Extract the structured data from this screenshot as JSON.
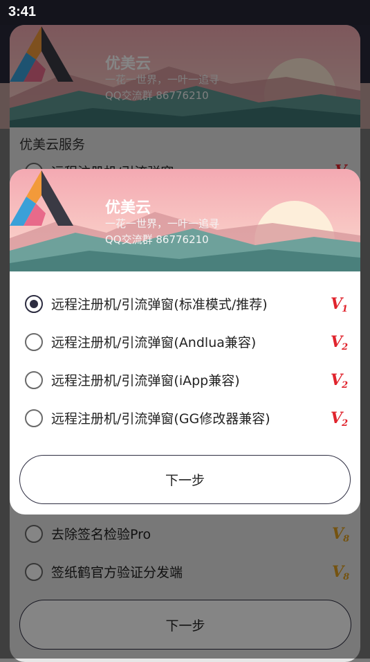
{
  "status_bar": {
    "time": "3:41"
  },
  "brand": {
    "title": "优美云",
    "subtitle": "一花一世界，一叶一追寻",
    "qq": "QQ交流群 86776210"
  },
  "background_page": {
    "section_title": "优美云服务",
    "options": [
      {
        "label": "远程注册机/引流弹窗",
        "badge": "V",
        "badge_num": "1",
        "badge_color": "#e0242d"
      },
      {
        "label": "去除签名检验Pro",
        "badge": "V",
        "badge_num": "8",
        "badge_color": "#e0a020"
      },
      {
        "label": "签纸鹤官方验证分发端",
        "badge": "V",
        "badge_num": "8",
        "badge_color": "#e0a020"
      }
    ],
    "next_label": "下一步"
  },
  "dialog": {
    "options": [
      {
        "label": "远程注册机/引流弹窗(标准模式/推荐)",
        "selected": true,
        "badge": "V",
        "badge_num": "1"
      },
      {
        "label": "远程注册机/引流弹窗(Andlua兼容)",
        "selected": false,
        "badge": "V",
        "badge_num": "2"
      },
      {
        "label": "远程注册机/引流弹窗(iApp兼容)",
        "selected": false,
        "badge": "V",
        "badge_num": "2"
      },
      {
        "label": "远程注册机/引流弹窗(GG修改器兼容)",
        "selected": false,
        "badge": "V",
        "badge_num": "2"
      }
    ],
    "next_label": "下一步"
  },
  "colors": {
    "accent": "#2c2c40",
    "badge_red": "#e0242d",
    "badge_gold": "#e0a020",
    "hero_pink": "#f2b8bc",
    "hero_teal": "#4d8a86"
  }
}
